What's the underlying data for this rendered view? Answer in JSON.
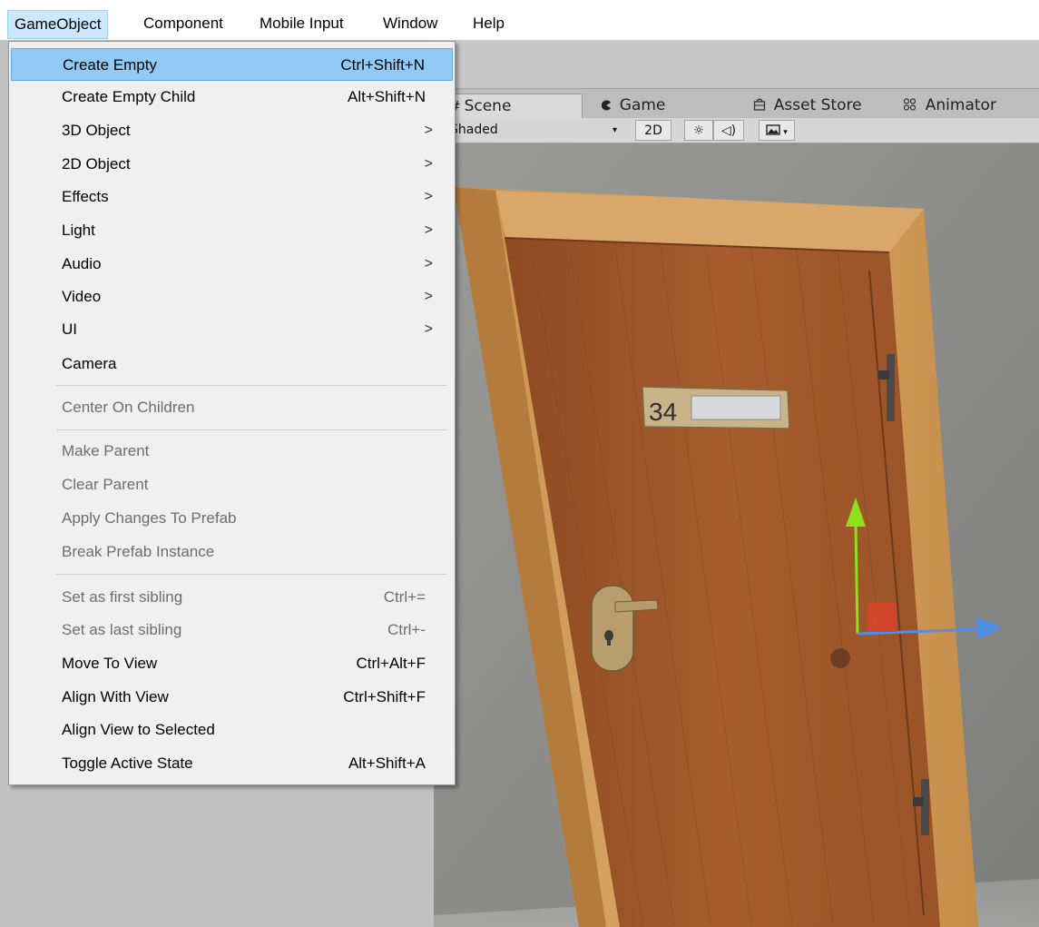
{
  "menubar": {
    "items": [
      {
        "label": "GameObject"
      },
      {
        "label": "Component"
      },
      {
        "label": "Mobile Input"
      },
      {
        "label": "Window"
      },
      {
        "label": "Help"
      }
    ]
  },
  "dropdown": {
    "items": [
      {
        "label": "Create Empty",
        "shortcut": "Ctrl+Shift+N"
      },
      {
        "label": "Create Empty Child",
        "shortcut": "Alt+Shift+N"
      },
      {
        "label": "3D Object",
        "arrow": ">"
      },
      {
        "label": "2D Object",
        "arrow": ">"
      },
      {
        "label": "Effects",
        "arrow": ">"
      },
      {
        "label": "Light",
        "arrow": ">"
      },
      {
        "label": "Audio",
        "arrow": ">"
      },
      {
        "label": "Video",
        "arrow": ">"
      },
      {
        "label": "UI",
        "arrow": ">"
      },
      {
        "label": "Camera"
      },
      {
        "label": "Center On Children"
      },
      {
        "label": "Make Parent"
      },
      {
        "label": "Clear Parent"
      },
      {
        "label": "Apply Changes To Prefab"
      },
      {
        "label": "Break Prefab Instance"
      },
      {
        "label": "Set as first sibling",
        "shortcut": "Ctrl+="
      },
      {
        "label": "Set as last sibling",
        "shortcut": "Ctrl+-"
      },
      {
        "label": "Move To View",
        "shortcut": "Ctrl+Alt+F"
      },
      {
        "label": "Align With View",
        "shortcut": "Ctrl+Shift+F"
      },
      {
        "label": "Align View to Selected"
      },
      {
        "label": "Toggle Active State",
        "shortcut": "Alt+Shift+A"
      }
    ]
  },
  "tabs": {
    "scene": {
      "icon": "#",
      "label": "Scene"
    },
    "game": {
      "icon": "pacman-icon",
      "label": "Game"
    },
    "asset_store": {
      "icon": "shopping-bag-icon",
      "label": "Asset Store"
    },
    "animator": {
      "icon": "animator-icon",
      "label": "Animator"
    }
  },
  "scene_toolbar": {
    "shading_mode": "Shaded",
    "mode_2d": "2D"
  },
  "scene": {
    "door_number": "34"
  },
  "colors": {
    "menu_highlight": "#91c9f7",
    "menubar_active": "#cce8ff",
    "door_wood": "#a0582c",
    "frame_wood": "#d8a764",
    "gizmo_y": "#8ee01d",
    "gizmo_x": "#4f8fe8",
    "gizmo_center": "#d8442a"
  }
}
